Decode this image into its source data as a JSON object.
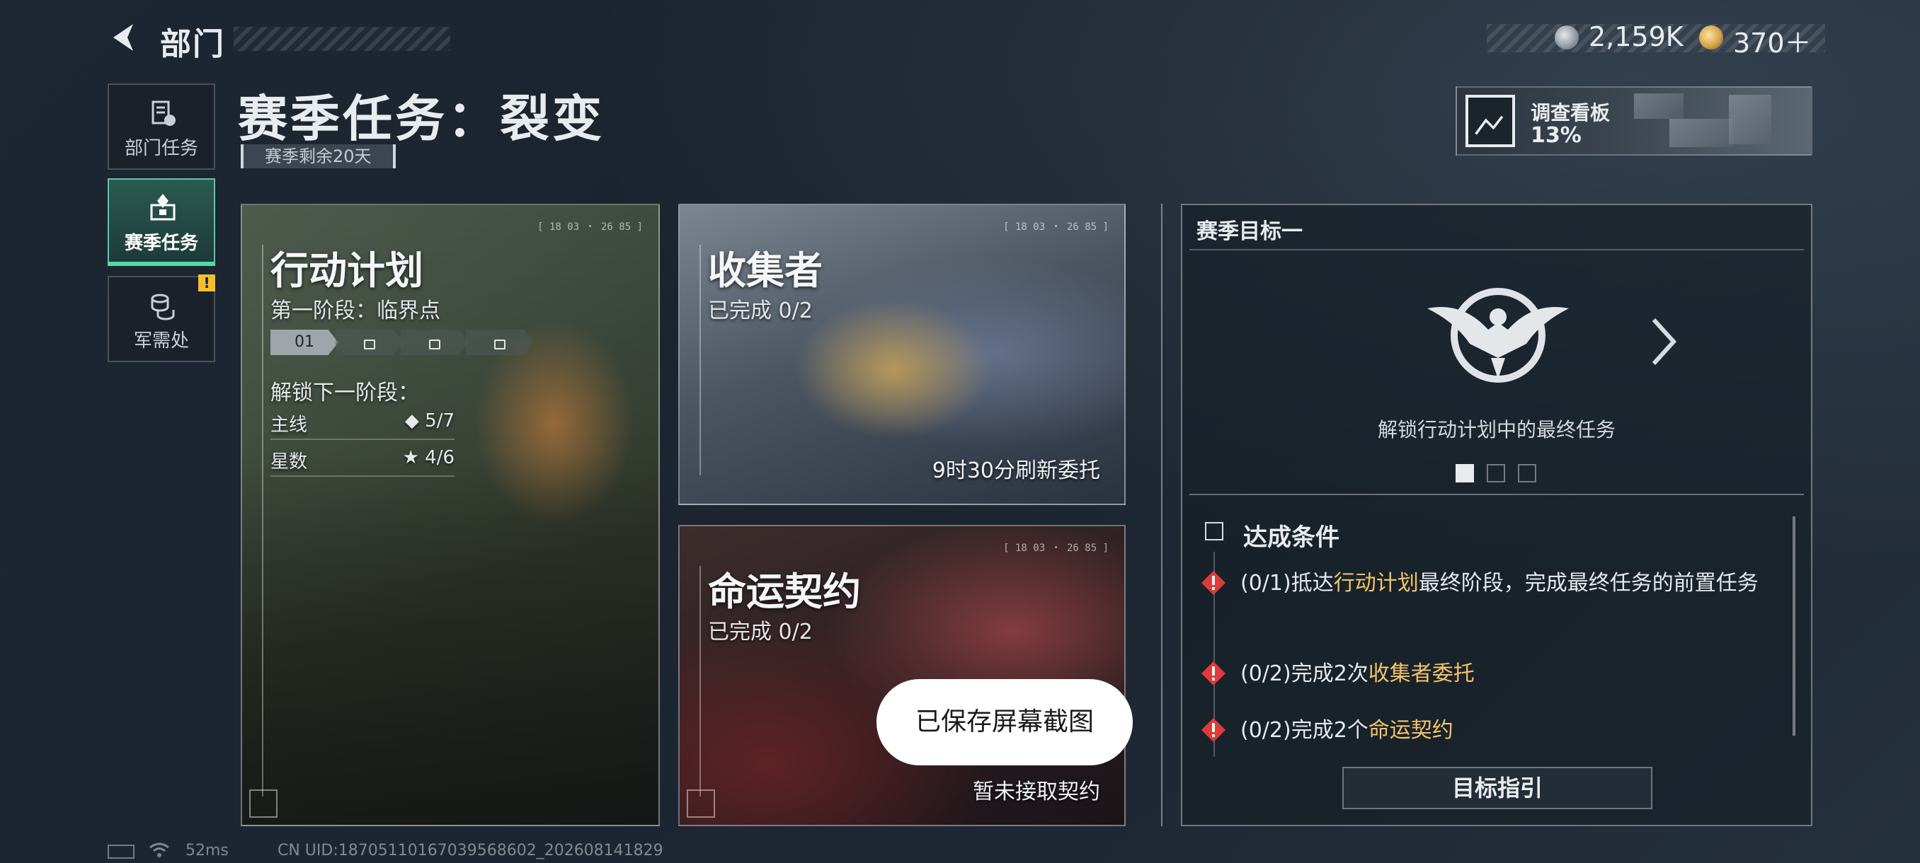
{
  "header": {
    "title": "部门",
    "currencies": [
      {
        "icon": "silver-coin-icon",
        "value": "2,159K"
      },
      {
        "icon": "gold-coin-icon",
        "value": "370＋"
      }
    ]
  },
  "nav": {
    "items": [
      {
        "label": "部门任务",
        "icon": "department-task-icon"
      },
      {
        "label": "赛季任务",
        "icon": "season-task-icon",
        "active": true
      },
      {
        "label": "军需处",
        "icon": "supply-icon",
        "badge": "!"
      }
    ]
  },
  "page": {
    "title": "赛季任务：裂变",
    "remaining": "赛季剩余20天"
  },
  "investigation": {
    "label": "调查看板",
    "percent": "13%"
  },
  "cards": {
    "operation": {
      "title": "行动计划",
      "subtitle": "第一阶段：临界点",
      "code": "[ 18 03 ・ 26 85 ]",
      "stages": [
        "01"
      ],
      "unlock_title": "解锁下一阶段：",
      "requirements": [
        {
          "label": "主线",
          "value": "◆ 5/7"
        },
        {
          "label": "星数",
          "value": "★ 4/6"
        }
      ]
    },
    "collector": {
      "title": "收集者",
      "subtitle": "已完成 0/2",
      "code": "[ 18 03 ・ 26 85 ]",
      "note": "9时30分刷新委托"
    },
    "fate": {
      "title": "命运契约",
      "subtitle": "已完成 0/2",
      "code": "[ 18 03 ・ 26 85 ]",
      "note": "暂未接取契约"
    }
  },
  "goal": {
    "header": "赛季目标一",
    "description": "解锁行动计划中的最终任务",
    "pages": 3,
    "active_page": 1,
    "conditions_title": "达成条件",
    "conditions": [
      {
        "pre": "(0/1)抵达",
        "hl": "行动计划",
        "post": "最终阶段，完成最终任务的前置任务"
      },
      {
        "pre": "(0/2)完成2次",
        "hl": "收集者委托",
        "post": ""
      },
      {
        "pre": "(0/2)完成2个",
        "hl": "命运契约",
        "post": ""
      }
    ],
    "guide_button": "目标指引"
  },
  "toast": "已保存屏幕截图",
  "footer": {
    "ping": "52ms",
    "uid": "CN UID:187051101670395686​02_202608141829"
  },
  "colors": {
    "accent_green": "#4fdca6",
    "highlight_gold": "#f2c46a",
    "warning_red": "#e03a3a"
  }
}
